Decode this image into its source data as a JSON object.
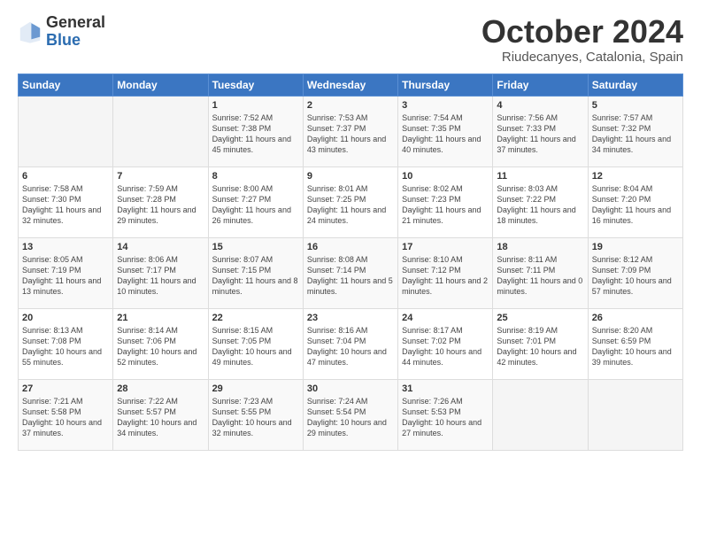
{
  "header": {
    "logo_general": "General",
    "logo_blue": "Blue",
    "month": "October 2024",
    "location": "Riudecanyes, Catalonia, Spain"
  },
  "days_of_week": [
    "Sunday",
    "Monday",
    "Tuesday",
    "Wednesday",
    "Thursday",
    "Friday",
    "Saturday"
  ],
  "weeks": [
    [
      {
        "day": "",
        "info": ""
      },
      {
        "day": "",
        "info": ""
      },
      {
        "day": "1",
        "info": "Sunrise: 7:52 AM\nSunset: 7:38 PM\nDaylight: 11 hours and 45 minutes."
      },
      {
        "day": "2",
        "info": "Sunrise: 7:53 AM\nSunset: 7:37 PM\nDaylight: 11 hours and 43 minutes."
      },
      {
        "day": "3",
        "info": "Sunrise: 7:54 AM\nSunset: 7:35 PM\nDaylight: 11 hours and 40 minutes."
      },
      {
        "day": "4",
        "info": "Sunrise: 7:56 AM\nSunset: 7:33 PM\nDaylight: 11 hours and 37 minutes."
      },
      {
        "day": "5",
        "info": "Sunrise: 7:57 AM\nSunset: 7:32 PM\nDaylight: 11 hours and 34 minutes."
      }
    ],
    [
      {
        "day": "6",
        "info": "Sunrise: 7:58 AM\nSunset: 7:30 PM\nDaylight: 11 hours and 32 minutes."
      },
      {
        "day": "7",
        "info": "Sunrise: 7:59 AM\nSunset: 7:28 PM\nDaylight: 11 hours and 29 minutes."
      },
      {
        "day": "8",
        "info": "Sunrise: 8:00 AM\nSunset: 7:27 PM\nDaylight: 11 hours and 26 minutes."
      },
      {
        "day": "9",
        "info": "Sunrise: 8:01 AM\nSunset: 7:25 PM\nDaylight: 11 hours and 24 minutes."
      },
      {
        "day": "10",
        "info": "Sunrise: 8:02 AM\nSunset: 7:23 PM\nDaylight: 11 hours and 21 minutes."
      },
      {
        "day": "11",
        "info": "Sunrise: 8:03 AM\nSunset: 7:22 PM\nDaylight: 11 hours and 18 minutes."
      },
      {
        "day": "12",
        "info": "Sunrise: 8:04 AM\nSunset: 7:20 PM\nDaylight: 11 hours and 16 minutes."
      }
    ],
    [
      {
        "day": "13",
        "info": "Sunrise: 8:05 AM\nSunset: 7:19 PM\nDaylight: 11 hours and 13 minutes."
      },
      {
        "day": "14",
        "info": "Sunrise: 8:06 AM\nSunset: 7:17 PM\nDaylight: 11 hours and 10 minutes."
      },
      {
        "day": "15",
        "info": "Sunrise: 8:07 AM\nSunset: 7:15 PM\nDaylight: 11 hours and 8 minutes."
      },
      {
        "day": "16",
        "info": "Sunrise: 8:08 AM\nSunset: 7:14 PM\nDaylight: 11 hours and 5 minutes."
      },
      {
        "day": "17",
        "info": "Sunrise: 8:10 AM\nSunset: 7:12 PM\nDaylight: 11 hours and 2 minutes."
      },
      {
        "day": "18",
        "info": "Sunrise: 8:11 AM\nSunset: 7:11 PM\nDaylight: 11 hours and 0 minutes."
      },
      {
        "day": "19",
        "info": "Sunrise: 8:12 AM\nSunset: 7:09 PM\nDaylight: 10 hours and 57 minutes."
      }
    ],
    [
      {
        "day": "20",
        "info": "Sunrise: 8:13 AM\nSunset: 7:08 PM\nDaylight: 10 hours and 55 minutes."
      },
      {
        "day": "21",
        "info": "Sunrise: 8:14 AM\nSunset: 7:06 PM\nDaylight: 10 hours and 52 minutes."
      },
      {
        "day": "22",
        "info": "Sunrise: 8:15 AM\nSunset: 7:05 PM\nDaylight: 10 hours and 49 minutes."
      },
      {
        "day": "23",
        "info": "Sunrise: 8:16 AM\nSunset: 7:04 PM\nDaylight: 10 hours and 47 minutes."
      },
      {
        "day": "24",
        "info": "Sunrise: 8:17 AM\nSunset: 7:02 PM\nDaylight: 10 hours and 44 minutes."
      },
      {
        "day": "25",
        "info": "Sunrise: 8:19 AM\nSunset: 7:01 PM\nDaylight: 10 hours and 42 minutes."
      },
      {
        "day": "26",
        "info": "Sunrise: 8:20 AM\nSunset: 6:59 PM\nDaylight: 10 hours and 39 minutes."
      }
    ],
    [
      {
        "day": "27",
        "info": "Sunrise: 7:21 AM\nSunset: 5:58 PM\nDaylight: 10 hours and 37 minutes."
      },
      {
        "day": "28",
        "info": "Sunrise: 7:22 AM\nSunset: 5:57 PM\nDaylight: 10 hours and 34 minutes."
      },
      {
        "day": "29",
        "info": "Sunrise: 7:23 AM\nSunset: 5:55 PM\nDaylight: 10 hours and 32 minutes."
      },
      {
        "day": "30",
        "info": "Sunrise: 7:24 AM\nSunset: 5:54 PM\nDaylight: 10 hours and 29 minutes."
      },
      {
        "day": "31",
        "info": "Sunrise: 7:26 AM\nSunset: 5:53 PM\nDaylight: 10 hours and 27 minutes."
      },
      {
        "day": "",
        "info": ""
      },
      {
        "day": "",
        "info": ""
      }
    ]
  ]
}
